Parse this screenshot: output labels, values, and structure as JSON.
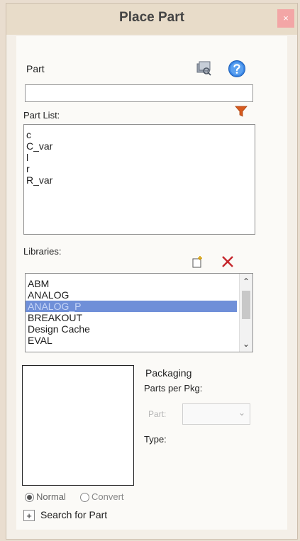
{
  "window": {
    "title": "Place Part",
    "close_glyph": "×"
  },
  "part": {
    "label": "Part",
    "value": ""
  },
  "part_list": {
    "label": "Part List:",
    "items": [
      "c",
      "C_var",
      "l",
      "r",
      "R_var"
    ]
  },
  "libraries": {
    "label": "Libraries:",
    "items": [
      "ABM",
      "ANALOG",
      "ANALOG_P",
      "BREAKOUT",
      "Design Cache",
      "EVAL"
    ],
    "selected": "ANALOG_P"
  },
  "packaging": {
    "title": "Packaging",
    "parts_per_pkg_label": "Parts per Pkg:",
    "part_label": "Part:",
    "type_label": "Type:"
  },
  "view_mode": {
    "normal_label": "Normal",
    "convert_label": "Convert",
    "selected": "Normal"
  },
  "search": {
    "toggle_glyph": "+",
    "label": "Search for Part"
  },
  "icons": {
    "library_browser": "library-browser-icon",
    "help": "help-icon",
    "filter": "filter-icon",
    "add_library": "add-library-icon",
    "remove_library": "remove-library-icon"
  },
  "colors": {
    "selection": "#6f8fd8",
    "filter": "#d75a1d",
    "remove": "#c5262c",
    "help": "#2f7de0"
  }
}
